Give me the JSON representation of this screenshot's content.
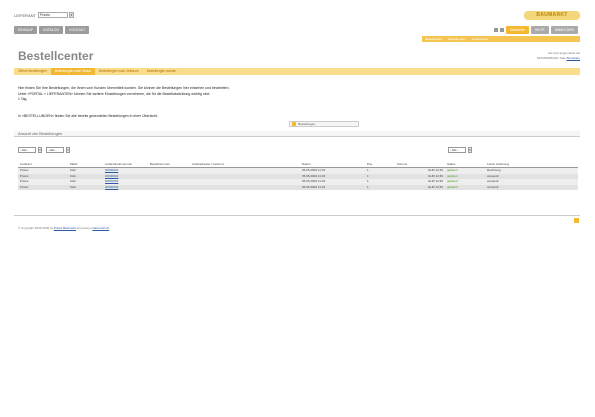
{
  "topbar": {
    "lieferant_label": "LIEFERANT",
    "lieferant_value": "Praxis",
    "logo_text": "BAUMARKT"
  },
  "mainnav": {
    "items": [
      "EINKAUF",
      "KATALOG",
      "KONTAKT"
    ],
    "right_items": [
      "Startseite",
      "HILFE",
      "ABMELDEN"
    ]
  },
  "subbar": {
    "items": [
      "Bestellcenter",
      "Bestellungen",
      "Lieferschein"
    ]
  },
  "page": {
    "title": "Bestellcenter",
    "meta_line1": "Sie sind angemeldet als",
    "meta_line2": "MUSTERMANN, Max",
    "meta_link": "Abmelden"
  },
  "tabs": [
    {
      "label": "Offene Bestellungen",
      "active": false
    },
    {
      "label": "Bestellungen nach Status",
      "active": true
    },
    {
      "label": "Bestellungen nach Zeitraum",
      "active": false
    },
    {
      "label": "Bestellungen suchen",
      "active": false
    }
  ],
  "info": {
    "line1": "Hier finden Sie Ihre Bestellungen, die Ihnen vom Kunden übermittelt wurden. Sie können die Bestellungen hier einsehen und bearbeiten.",
    "line2": "Unter »PORTAL » LIEFERANTEN« können Sie weitere Einstellungen vornehmen, die für die Bestellabwicklung wichtig sind.",
    "line3": "1 Tag",
    "line4": "In »BESTELLUNGEN« finden Sie alle bereits gesendeten Bestellungen in einer Übersicht.",
    "search_btn": "Bestellungen"
  },
  "section": {
    "title": "Ansicht der Bestellungen"
  },
  "filters": {
    "left": [
      "- Alle -",
      "- Alle -"
    ],
    "right": [
      "- Alle -"
    ]
  },
  "table": {
    "headers": [
      "Lieferant",
      "Markt",
      "Lieferscheinnummer",
      "Bestellnummer",
      "Lieferadresse / Lieferort",
      "Datum",
      "Pos.",
      "Summe",
      "Status",
      "Letzte Änderung"
    ],
    "rows": [
      [
        "Praxis",
        "Köln",
        "00090001",
        "",
        "",
        "05.05.2009 11:33",
        "1",
        "EUR 12,50",
        "geliefert",
        "Rechnung"
      ],
      [
        "Praxis",
        "Köln",
        "00090002",
        "",
        "",
        "05.05.2009 11:33",
        "1",
        "EUR 12,50",
        "geliefert",
        "versandt"
      ],
      [
        "Praxis",
        "Köln",
        "00090003",
        "",
        "",
        "05.05.2009 11:33",
        "1",
        "EUR 12,50",
        "geliefert",
        "versandt"
      ],
      [
        "Praxis",
        "Köln",
        "00090004",
        "",
        "",
        "05.05.2009 11:33",
        "1",
        "EUR 12,50",
        "geliefert",
        "versandt"
      ]
    ]
  },
  "footer": {
    "text": "© Copyright 2003-2009 by",
    "link1": "Praxis Baumarkt",
    "sep": "Impressum",
    "link2": "Datenschutz"
  }
}
